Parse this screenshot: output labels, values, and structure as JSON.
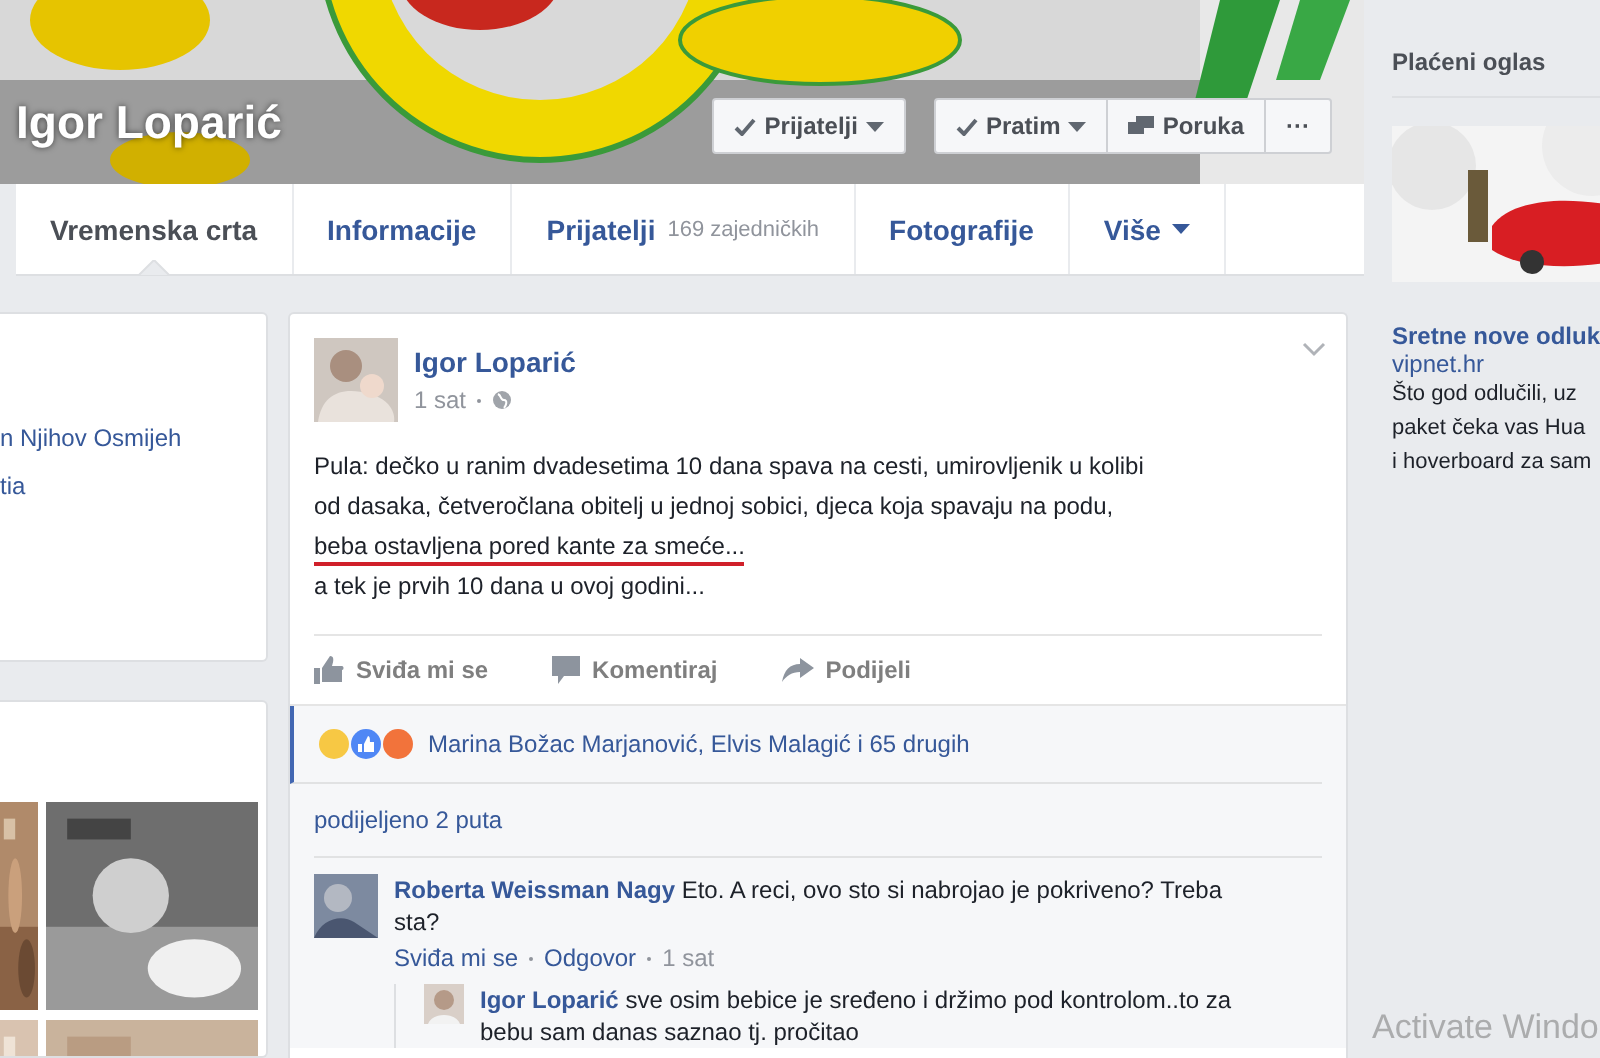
{
  "cover": {
    "name": "Igor Loparić",
    "buttons": [
      {
        "label": "Prijatelji",
        "kind": "dropdown"
      },
      {
        "label": "Pratim",
        "kind": "dropdown"
      },
      {
        "label": "Poruka",
        "kind": "message"
      },
      {
        "label": "···",
        "kind": "more"
      }
    ]
  },
  "tabs": [
    {
      "label": "Vremenska crta",
      "selected": true
    },
    {
      "label": "Informacije",
      "selected": false
    },
    {
      "label": "Prijatelji",
      "count": "169 zajedničkih",
      "selected": false
    },
    {
      "label": "Fotografije",
      "selected": false
    },
    {
      "label": "Više",
      "kind": "dropdown",
      "selected": false
    }
  ],
  "left_column": {
    "intro_lines": [
      "n Njihov Osmijeh",
      "tia"
    ]
  },
  "post": {
    "author": "Igor Loparić",
    "time": "1 sat",
    "lines": [
      {
        "text": "Pula: dečko u ranim dvadesetima 10 dana spava na cesti, umirovljenik u kolibi",
        "underlined": false
      },
      {
        "text": "od dasaka, četveročlana obitelj u jednoj sobici, djeca koja spavaju na podu,",
        "underlined": false
      },
      {
        "text": "beba ostavljena pored kante za smeće...",
        "underlined": true
      },
      {
        "text": "a tek je prvih 10 dana u ovoj godini...",
        "underlined": false
      }
    ],
    "actions": [
      "Sviđa mi se",
      "Komentiraj",
      "Podijeli"
    ],
    "reactions": {
      "text": "Marina Božac Marjanović, Elvis Malagić i 65 drugih"
    },
    "shares": "podijeljeno 2 puta",
    "comments": [
      {
        "author": "Roberta Weissman Nagy",
        "text": "Eto. A reci, ovo sto si nabrojao je pokriveno? Treba sta?",
        "meta": [
          "Sviđa mi se",
          "Odgovor",
          "1 sat"
        ],
        "replies": [
          {
            "author": "Igor Loparić",
            "text": "sve osim bebice je sređeno i držimo pod kontrolom..to za bebu sam danas saznao tj. pročitao"
          }
        ]
      }
    ]
  },
  "sidebar": {
    "heading": "Plaćeni oglas",
    "ad": {
      "title": "Sretne nove odluk",
      "domain": "vipnet.hr",
      "lines": [
        "Što god odlučili, uz",
        "paket čeka vas Hua",
        "i hoverboard za sam"
      ]
    }
  },
  "activation_notice": "Activate Windo"
}
